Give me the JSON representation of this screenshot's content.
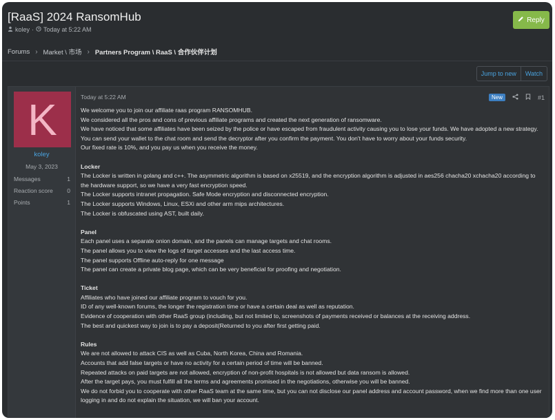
{
  "thread": {
    "title": "[RaaS] 2024 RansomHub",
    "author": "koley",
    "date": "Today at 5:22 AM"
  },
  "actions": {
    "reply_label": "Reply",
    "jump_label": "Jump to new",
    "watch_label": "Watch"
  },
  "breadcrumb": [
    "Forums",
    "Market \\ 市场",
    "Partners Program \\ RaaS \\ 合作伙伴计划"
  ],
  "user": {
    "avatar_letter": "K",
    "name": "koley",
    "joined": "May 3, 2023",
    "stats": [
      {
        "label": "Messages",
        "value": "1"
      },
      {
        "label": "Reaction score",
        "value": "0"
      },
      {
        "label": "Points",
        "value": "1"
      }
    ]
  },
  "post": {
    "time": "Today at 5:22 AM",
    "badge": "New",
    "number": "#1",
    "intro": [
      "We welcome you to join our affiliate raas program RANSOMHUB.",
      "We considered all the pros and cons of previous affiliate programs and created the next generation of ransomware.",
      "We have noticed that some affiliates have been seized by the police or have escaped from fraudulent activity causing you to lose your funds. We have adopted a new strategy. You can send your wallet to the chat room and send the decryptor after you confirm the payment. You don't have to worry about your funds security.",
      "Our fixed rate is 10%, and you pay us when you receive the money."
    ],
    "locker_title": "Locker",
    "locker": [
      "The Locker is written in golang and c++. The asymmetric algorithm is based on x25519, and the encryption algorithm is adjusted in aes256 chacha20 xchacha20 according to the hardware support, so we have a very fast encryption speed.",
      "The Locker supports intranet propagation. Safe Mode encryption and disconnected encryption.",
      "The Locker supports Windows, Linux, ESXi and other arm mips architectures.",
      "The Locker is obfuscated using AST, built daily."
    ],
    "panel_title": "Panel",
    "panel": [
      "Each panel uses a separate onion domain, and the panels can manage targets and chat rooms.",
      "The panel allows you to view the logs of target accesses and the last access time.",
      "The panel supports Offline auto-reply for one message",
      "The panel can create a private blog page, which can be very beneficial for proofing and negotiation."
    ],
    "ticket_title": "Ticket",
    "ticket": [
      "Affiliates who have joined our affiliate program to vouch for you.",
      "ID of any well-known forums, the longer the registration time or have a certain deal as well as reputation.",
      "Evidence of cooperation with other RaaS group (including, but not limited to, screenshots of payments received or balances at the receiving address.",
      "The best and quickest way to join is to pay a deposit(Returned to you after first getting paid."
    ],
    "rules_title": "Rules",
    "rules": [
      "We are not allowed to attack CIS as well as Cuba, North Korea, China and Romania.",
      "Accounts that add false targets or have no activity for a certain period of time will be banned.",
      "Repeated attacks on paid targets are not allowed, encryption of non-profit hospitals is not allowed but data ransom is allowed.",
      "After the target pays, you must fulfill all the terms and agreements promised in the negotiations, otherwise you will be banned.",
      "We do not forbid you to cooperate with other RaaS team at the same time, but you can not disclose our panel address and account password, when we find more than one user logging in and do not explain the situation, we will ban your account."
    ]
  },
  "colors": {
    "background": "#2a2d30",
    "reply_button": "#86b94a",
    "link": "#4aa3df",
    "avatar": "#9c2f4a",
    "new_badge": "#3d7fc1"
  },
  "icons": [
    "user-icon",
    "clock-icon",
    "pencil-icon",
    "chevron-right-icon",
    "share-icon",
    "bookmark-icon"
  ]
}
